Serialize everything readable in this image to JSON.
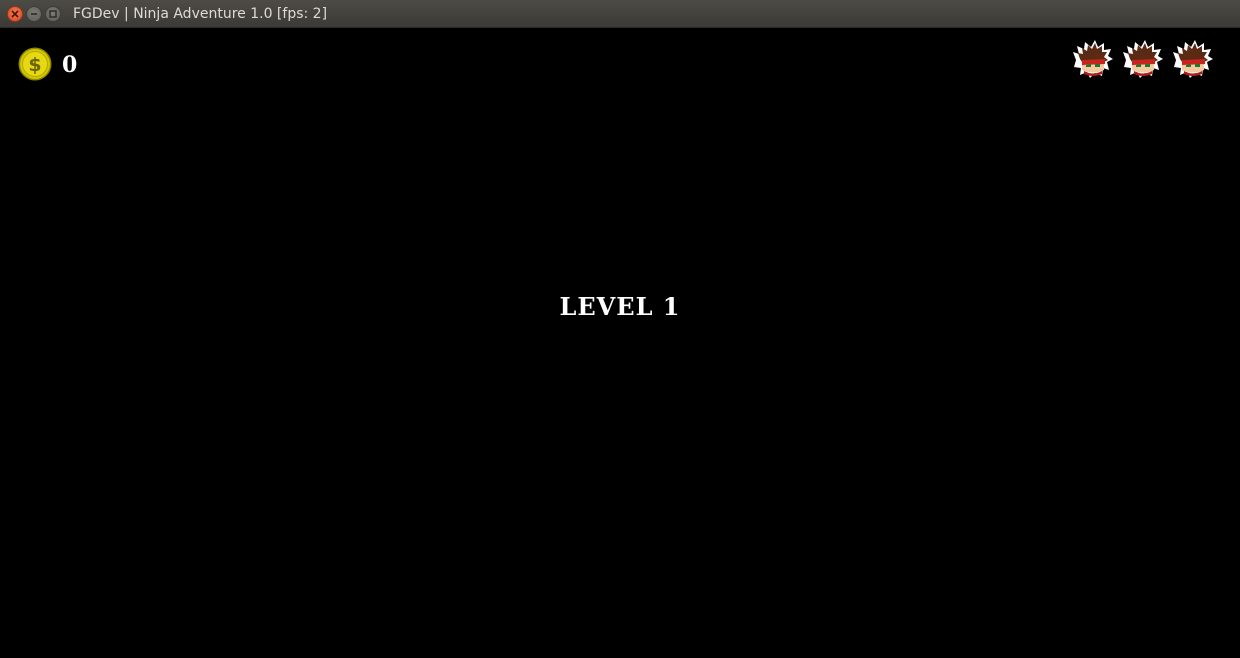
{
  "window": {
    "title": "FGDev | Ninja Adventure 1.0 [fps: 2]"
  },
  "hud": {
    "coins": "0",
    "lives": 3,
    "coin_color": "#d4c800",
    "life_icon": "ninja-head-icon"
  },
  "level": {
    "label": "LEVEL 1"
  }
}
